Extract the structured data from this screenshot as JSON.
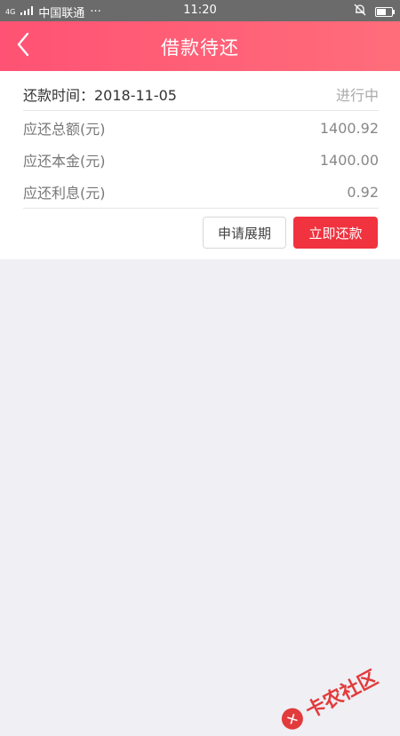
{
  "status_bar": {
    "network": "4G",
    "carrier": "中国联通",
    "dots": "···",
    "time": "11:20"
  },
  "nav": {
    "title": "借款待还",
    "back_icon": "chevron-left-icon"
  },
  "loan": {
    "due_label": "还款时间：2018-11-05",
    "status": "进行中",
    "rows": [
      {
        "label": "应还总额(元)",
        "value": "1400.92"
      },
      {
        "label": "应还本金(元)",
        "value": "1400.00"
      },
      {
        "label": "应还利息(元)",
        "value": "0.92"
      }
    ]
  },
  "actions": {
    "extend_label": "申请展期",
    "repay_label": "立即还款"
  },
  "watermark": {
    "logo_char": "✕",
    "text": "卡农社区"
  },
  "colors": {
    "nav_gradient_start": "#ff5274",
    "nav_gradient_end": "#ff6d7a",
    "repay_button": "#f0333f",
    "background": "#efeff4"
  }
}
